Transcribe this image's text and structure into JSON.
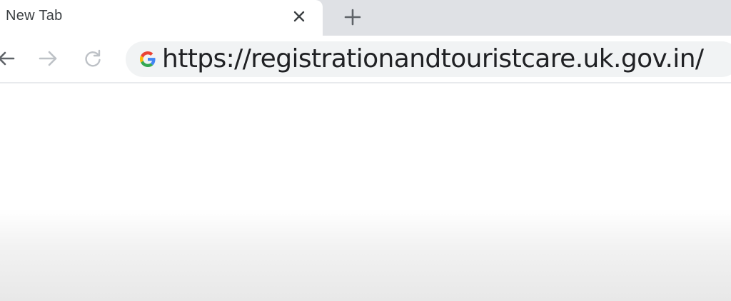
{
  "tabs": [
    {
      "title": "New Tab"
    }
  ],
  "omnibox": {
    "url": "https://registrationandtouristcare.uk.gov.in/"
  },
  "icons": {
    "tab_close": "close-icon",
    "new_tab": "plus-icon",
    "back": "arrow-left-icon",
    "forward": "arrow-right-icon",
    "reload": "reload-icon",
    "search_engine": "google-g-icon"
  },
  "colors": {
    "tab_strip": "#dfe1e5",
    "omnibox_bg": "#f1f3f4",
    "google_blue": "#4285f4",
    "google_red": "#ea4335",
    "google_yellow": "#fbbc05",
    "google_green": "#34a853"
  }
}
